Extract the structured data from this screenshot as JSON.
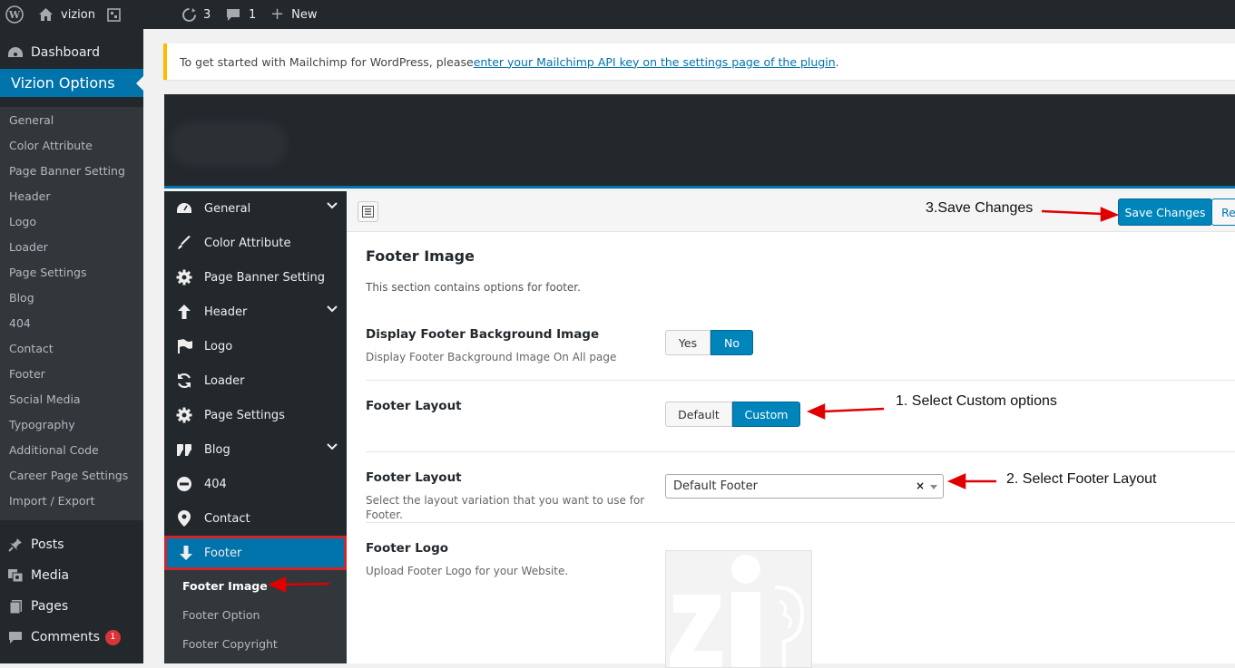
{
  "admin_bar": {
    "site_name": "vizion",
    "updates_count": "3",
    "comments_count": "1",
    "new_label": "New"
  },
  "admin_menu": {
    "dashboard": "Dashboard",
    "current": "Vizion Options",
    "submenu": [
      "General",
      "Color Attribute",
      "Page Banner Setting",
      "Header",
      "Logo",
      "Loader",
      "Page Settings",
      "Blog",
      "404",
      "Contact",
      "Footer",
      "Social Media",
      "Typography",
      "Additional Code",
      "Career Page Settings",
      "Import / Export"
    ],
    "posts": "Posts",
    "media": "Media",
    "pages": "Pages",
    "comments": "Comments",
    "comments_badge": "1"
  },
  "notice": {
    "text": "To get started with Mailchimp for WordPress, please ",
    "link": "enter your Mailchimp API key on the settings page of the plugin",
    "end": "."
  },
  "redux_sidebar": {
    "items": [
      "General",
      "Color Attribute",
      "Page Banner Setting",
      "Header",
      "Logo",
      "Loader",
      "Page Settings",
      "Blog",
      "404",
      "Contact",
      "Footer"
    ],
    "footer_sub": [
      "Footer Image",
      "Footer Option",
      "Footer Copyright"
    ]
  },
  "toolbar": {
    "save_label": "Save Changes",
    "reset_label": "Re"
  },
  "section": {
    "title": "Footer Image",
    "desc": "This section contains options for footer."
  },
  "fields": {
    "bg_image": {
      "title": "Display Footer Background Image",
      "desc": "Display Footer Background Image On All page",
      "options": [
        "Yes",
        "No"
      ],
      "selected": "No"
    },
    "layout_mode": {
      "title": "Footer Layout",
      "options": [
        "Default",
        "Custom"
      ],
      "selected": "Custom"
    },
    "layout_select": {
      "title": "Footer Layout",
      "desc": "Select the layout variation that you want to use for Footer.",
      "value": "Default Footer",
      "clear": "×"
    },
    "logo": {
      "title": "Footer Logo",
      "desc": "Upload Footer Logo for your Website."
    }
  },
  "annotations": {
    "step1": "1. Select Custom options",
    "step2": "2. Select Footer Layout",
    "step3": "3.Save Changes",
    "arrow_color": "#e00000"
  },
  "colors": {
    "admin_dark": "#23282d",
    "accent_blue": "#0073aa",
    "notice_yellow": "#ffb900",
    "highlight_red": "#d0262b"
  }
}
